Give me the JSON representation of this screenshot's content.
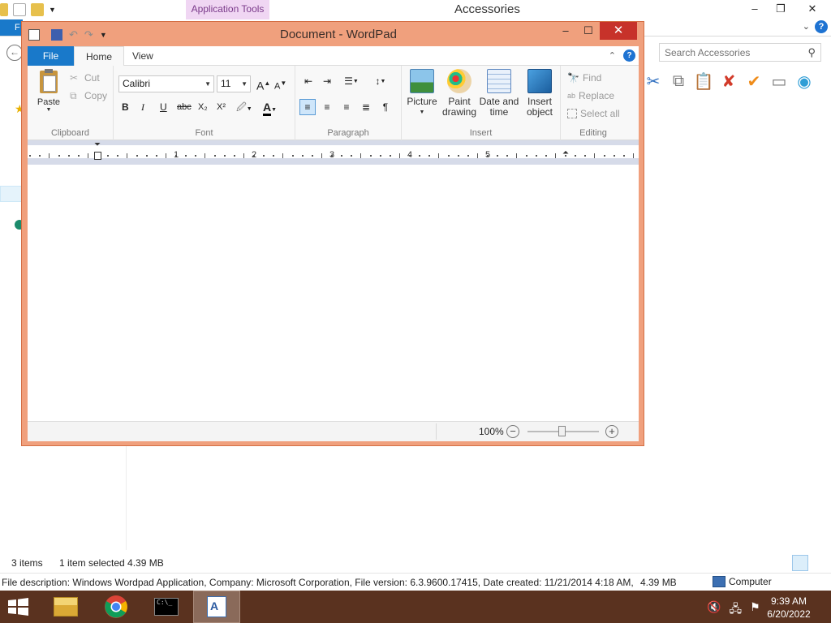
{
  "explorer": {
    "title": "Accessories",
    "context_tab": "Application Tools",
    "file_tab": "F",
    "search_placeholder": "Search Accessories",
    "status_items": "3 items",
    "status_selected": "1 item selected  4.39 MB",
    "description": "File description: Windows Wordpad Application, Company: Microsoft Corporation, File version: 6.3.9600.17415, Date created: 11/21/2014 4:18 AM, Size",
    "desc_size": "4.39 MB",
    "desc_location": "Computer",
    "controls": {
      "minimize": "–",
      "maximize": "❐",
      "close": "✕"
    }
  },
  "wordpad": {
    "title": "Document - WordPad",
    "tabs": {
      "file": "File",
      "home": "Home",
      "view": "View"
    },
    "clipboard": {
      "paste": "Paste",
      "cut": "Cut",
      "copy": "Copy",
      "label": "Clipboard"
    },
    "font": {
      "name": "Calibri",
      "size": "11",
      "label": "Font",
      "grow": "A",
      "shrink": "A",
      "bold": "B",
      "italic": "I",
      "underline": "U",
      "strike": "abc",
      "sub": "X₂",
      "sup": "X²",
      "color_letter": "A"
    },
    "paragraph": {
      "label": "Paragraph"
    },
    "insert": {
      "picture": "Picture",
      "paint1": "Paint",
      "paint2": "drawing",
      "date1": "Date and",
      "date2": "time",
      "object1": "Insert",
      "object2": "object",
      "label": "Insert"
    },
    "editing": {
      "find": "Find",
      "replace": "Replace",
      "select_all": "Select all",
      "label": "Editing"
    },
    "ruler_numbers": [
      "1",
      "2",
      "3",
      "4",
      "5"
    ],
    "zoom": "100%",
    "controls": {
      "minimize": "–",
      "maximize": "☐",
      "close": "✕"
    }
  },
  "taskbar": {
    "time": "9:39 AM",
    "date": "6/20/2022"
  },
  "colors": {
    "wordpad_frame": "#f0a07d",
    "ribbon_blue": "#1979ca",
    "taskbar": "#5a321f",
    "close_red": "#c7322a"
  }
}
